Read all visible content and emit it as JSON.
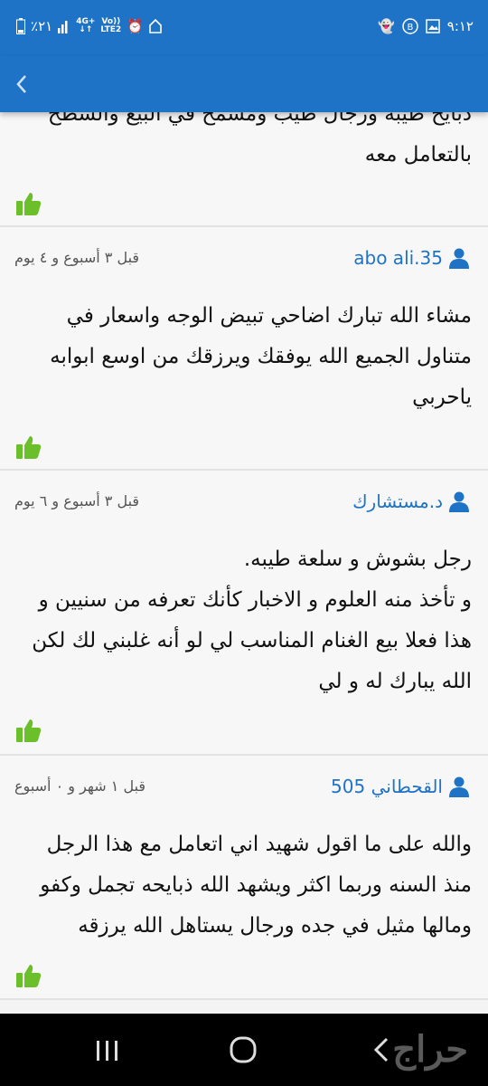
{
  "status_bar": {
    "time": "٩:١٢",
    "battery": "٪٢١",
    "network_top": "4G+",
    "network_bottom": "LTE2",
    "volte_top": "Vo))",
    "volte_bottom": "LTE2"
  },
  "app_bar": {
    "back_icon": "chevron-left-icon"
  },
  "comments": [
    {
      "partial": true,
      "lines": [
        "ذبايح طيبة ورجال طيب ومسمح في البيع والشطح",
        "بالتعامل معه"
      ]
    },
    {
      "user": "abo ali.35",
      "time": "قبل ٣ أسبوع و ٤ يوم",
      "lines": [
        "مشاء الله تبارك اضاحي تبيض الوجه واسعار في",
        "متناول الجميع الله يوفقك ويرزقك من اوسع ابوابه",
        "ياحربي"
      ]
    },
    {
      "user": "د.مستشارك",
      "time": "قبل ٣ أسبوع و ٦ يوم",
      "lines": [
        "رجل بشوش و سلعة طيبه.",
        "و تأخذ منه العلوم و الاخبار كأنك تعرفه من سنيين و",
        "هذا فعلا بيع الغنام المناسب لي لو أنه غلبني لك لكن",
        "الله يبارك له و لي"
      ]
    },
    {
      "user": "القحطاني 505",
      "time": "قبل ١ شهر و ٠ أسبوع",
      "lines": [
        "والله على ما اقول شهيد اني اتعامل مع هذا الرجل",
        "منذ السنه وربما اكثر ويشهد الله ذبايحه تجمل وكفو",
        "ومالها مثيل في جده ورجال يستاهل الله يرزقه"
      ]
    }
  ],
  "nav": {
    "brand": "حراج"
  },
  "colors": {
    "primary": "#1f73c7",
    "like_green": "#6abf2a"
  }
}
